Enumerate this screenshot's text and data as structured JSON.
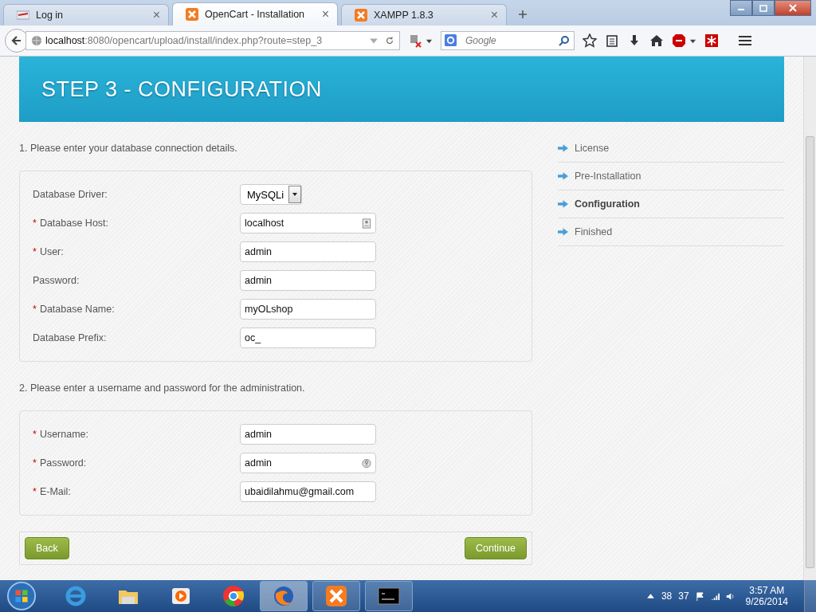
{
  "browser": {
    "tabs": [
      {
        "title": "Log in",
        "selected": false,
        "close": "×"
      },
      {
        "title": "OpenCart - Installation",
        "selected": true,
        "close": "×"
      },
      {
        "title": "XAMPP 1.8.3",
        "selected": false,
        "close": "×"
      }
    ],
    "url_host": "localhost",
    "url_path": ":8080/opencart/upload/install/index.php?route=step_3",
    "search_placeholder": "Google"
  },
  "page": {
    "heading": "STEP 3 - CONFIGURATION",
    "sections": [
      {
        "title": "1. Please enter your database connection details.",
        "fields": [
          {
            "label": "Database Driver:",
            "kind": "select",
            "value": "MySQLi"
          },
          {
            "label": "Database Host:",
            "marker": "*",
            "kind": "text",
            "value": "localhost"
          },
          {
            "label": "User:",
            "marker": "*",
            "kind": "text",
            "value": "admin"
          },
          {
            "label": "Password:",
            "kind": "text",
            "value": "admin"
          },
          {
            "label": "Database Name:",
            "marker": "*",
            "kind": "text",
            "value": "myOLshop"
          },
          {
            "label": "Database Prefix:",
            "kind": "text",
            "value": "oc_"
          }
        ]
      },
      {
        "title": "2. Please enter a username and password for the administration.",
        "fields": [
          {
            "label": "Username:",
            "marker": "*",
            "kind": "text",
            "value": "admin"
          },
          {
            "label": "Password:",
            "marker": "*",
            "kind": "text",
            "value": "admin"
          },
          {
            "label": "E-Mail:",
            "marker": "*",
            "kind": "text",
            "value": "ubaidilahmu@gmail.com"
          }
        ]
      }
    ],
    "buttons": {
      "back": "Back",
      "continue": "Continue"
    },
    "steps": [
      {
        "label": "License",
        "selected": false
      },
      {
        "label": "Pre-Installation",
        "selected": false
      },
      {
        "label": "Configuration",
        "selected": true
      },
      {
        "label": "Finished",
        "selected": false
      }
    ]
  },
  "taskbar": {
    "tray": [
      "38",
      "37"
    ],
    "time": "3:57 AM",
    "date": "9/26/2014"
  }
}
